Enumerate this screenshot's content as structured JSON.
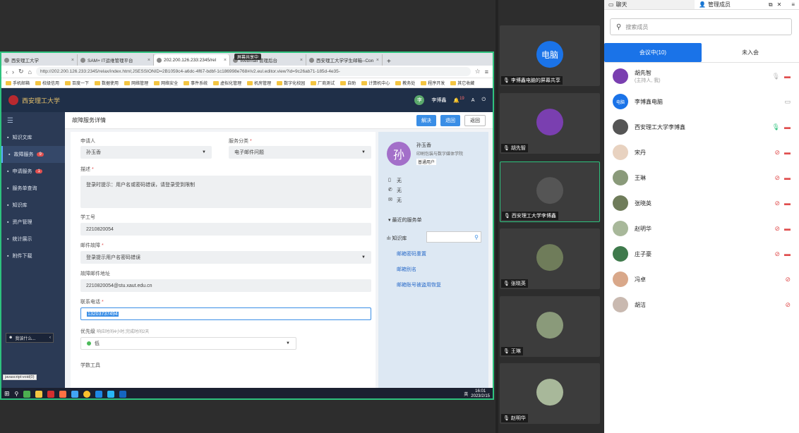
{
  "browser": {
    "tabs": [
      {
        "label": "西安理工大学",
        "active": false
      },
      {
        "label": "SAM+ IT运维管理平台",
        "active": false
      },
      {
        "label": "202.200.126.233:2345/rel",
        "active": true
      },
      {
        "label": "Webmail 管理后台",
        "active": false
      },
      {
        "label": "西安理工大学学生邮箱--Con",
        "active": false
      }
    ],
    "url": "http://202.200.126.233:2345/relax/index.html;JSESSIONID=2B1059c4-a6dc-4f67-bdbf-1c186998e768#/v2.eul.editor.view?id=9c26ab71-185d-4e35-",
    "bookmarks": [
      "手机邮箱",
      "校级信用",
      "百度一下",
      "数据使用",
      "网络管理",
      "网络安全",
      "事件系统",
      "虚拟化管理",
      "机房管理",
      "数字化校园",
      "厂商测试",
      "自助",
      "计算机中心",
      "教务处",
      "程序开发",
      "其它收藏"
    ],
    "sharing_label": "屏幕共享中"
  },
  "app": {
    "logo_text": "西安理工大学",
    "user_name": "李博鑫",
    "notification_count": "19",
    "sidebar": [
      {
        "label": "知识文库",
        "badge": ""
      },
      {
        "label": "故障服务",
        "badge": "9"
      },
      {
        "label": "申请服务",
        "badge": "1"
      },
      {
        "label": "服务单查询",
        "badge": ""
      },
      {
        "label": "知识库",
        "badge": ""
      },
      {
        "label": "资产管理",
        "badge": ""
      },
      {
        "label": "统计展示",
        "badge": ""
      },
      {
        "label": "附件下载",
        "badge": ""
      }
    ],
    "sidebar_bottom": "我该什么...",
    "page_title": "故障服务详情",
    "actions": {
      "resolve": "解决",
      "back": "退回",
      "return": "返回"
    },
    "form": {
      "applicant_label": "申请人",
      "applicant_value": "孙玉香",
      "category_label": "服务分类",
      "category_value": "电子邮件问题",
      "desc_label": "描述",
      "desc_value": "登录时提示：用户名或密码错误，请登录受到限制",
      "id_label": "学工号",
      "id_value": "2210820054",
      "fault_label": "邮件故障",
      "fault_value": "登录提示用户名密码错误",
      "email_label": "故障邮件地址",
      "email_value": "2210820054@stu.xaut.edu.cn",
      "phone_label": "联系电话",
      "phone_value": "13203737494",
      "priority_label": "优先级",
      "priority_hint": "响应时间4小时,完成时间2天",
      "priority_value": "低",
      "worker_label": "学数工具"
    },
    "info": {
      "avatar_char": "孙",
      "name": "孙玉香",
      "dept": "印刷包装与数字媒体学院",
      "role": "普通用户",
      "phone": "无",
      "mobile": "无",
      "mail": "无",
      "recent_label": "最近的服务单",
      "kb_label": "知识库",
      "kb_links": [
        "邮箱密码重置",
        "邮箱别名",
        "邮箱账号被盗用恢复"
      ]
    }
  },
  "taskbar": {
    "time": "16:01",
    "date": "2023/2/15",
    "ime": "英",
    "js_tip": "javascript:void(0)"
  },
  "video_tiles": [
    {
      "name": "李博鑫电脑的屏幕共享",
      "avatar_text": "电脑",
      "avatar_color": "#1a73e8"
    },
    {
      "name": "胡先智",
      "avatar_text": "",
      "avatar_color": "#7a3fb0"
    },
    {
      "name": "西安理工大学李博鑫",
      "avatar_text": "",
      "avatar_color": "#555555"
    },
    {
      "name": "张晓英",
      "avatar_text": "",
      "avatar_color": "#6f7c5a"
    },
    {
      "name": "王琳",
      "avatar_text": "",
      "avatar_color": "#8a9a7a"
    },
    {
      "name": "赵明华",
      "avatar_text": "",
      "avatar_color": "#a8b89a"
    }
  ],
  "panel": {
    "tab_chat": "聊天",
    "tab_members": "管理成员",
    "search_placeholder": "搜索成员",
    "seg_in": "会议中(10)",
    "seg_out": "未入会",
    "members": [
      {
        "name": "胡先智",
        "sub": "(主持人, 我)",
        "avatar_text": "",
        "avatar_color": "#7a3fb0",
        "mic": "idle",
        "cam": "off"
      },
      {
        "name": "李博鑫电脑",
        "sub": "",
        "avatar_text": "电脑",
        "avatar_color": "#1a73e8",
        "mic": "none",
        "cam": "screen"
      },
      {
        "name": "西安理工大学李博鑫",
        "sub": "",
        "avatar_text": "",
        "avatar_color": "#555555",
        "mic": "on",
        "cam": "off"
      },
      {
        "name": "宋丹",
        "sub": "",
        "avatar_text": "",
        "avatar_color": "#e8d2c0",
        "mic": "muted",
        "cam": "off"
      },
      {
        "name": "王琳",
        "sub": "",
        "avatar_text": "",
        "avatar_color": "#8a9a7a",
        "mic": "muted",
        "cam": "off"
      },
      {
        "name": "张晓英",
        "sub": "",
        "avatar_text": "",
        "avatar_color": "#6f7c5a",
        "mic": "muted",
        "cam": "off"
      },
      {
        "name": "赵明华",
        "sub": "",
        "avatar_text": "",
        "avatar_color": "#a8b89a",
        "mic": "muted",
        "cam": "off"
      },
      {
        "name": "庄子豪",
        "sub": "",
        "avatar_text": "",
        "avatar_color": "#3f7a4c",
        "mic": "muted",
        "cam": "off"
      },
      {
        "name": "冯卓",
        "sub": "",
        "avatar_text": "",
        "avatar_color": "#d9a88a",
        "mic": "muted",
        "cam": ""
      },
      {
        "name": "胡洁",
        "sub": "",
        "avatar_text": "",
        "avatar_color": "#c9b9b0",
        "mic": "muted",
        "cam": ""
      }
    ]
  }
}
